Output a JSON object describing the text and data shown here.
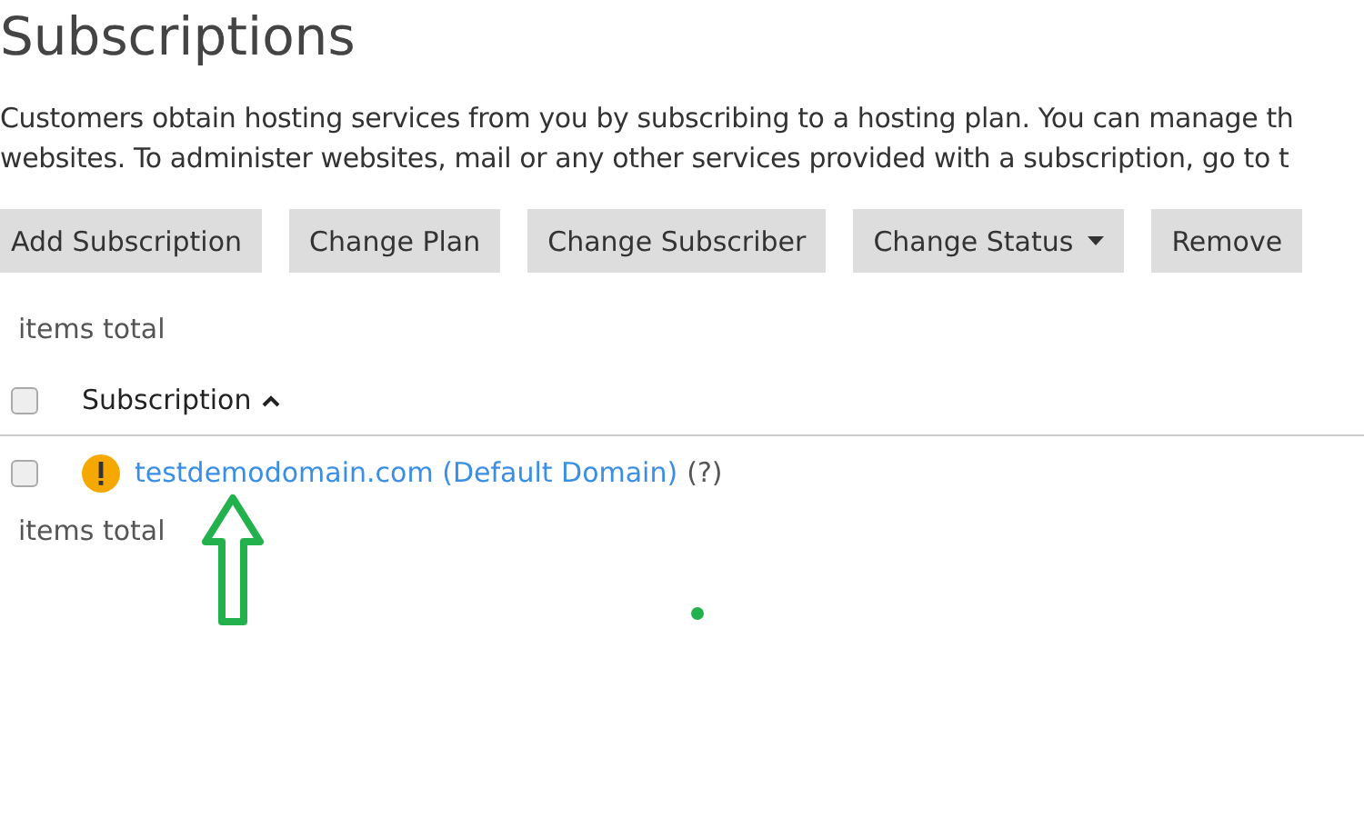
{
  "title": "Subscriptions",
  "description": [
    "Customers obtain hosting services from you by subscribing to a hosting plan. You can manage th",
    "websites. To administer websites, mail or any other services provided with a subscription, go to t"
  ],
  "toolbar": [
    {
      "label": "Add Subscription",
      "kind": "button"
    },
    {
      "label": "Change Plan",
      "kind": "button"
    },
    {
      "label": "Change Subscriber",
      "kind": "button"
    },
    {
      "label": "Change Status",
      "kind": "dropdown"
    },
    {
      "label": "Remove",
      "kind": "button"
    }
  ],
  "items_total_top": "items total",
  "table": {
    "select_all": {
      "checked": false
    },
    "columns": [
      {
        "label": "Subscription",
        "sorted_ascending": true
      }
    ],
    "rows": [
      {
        "checked": false,
        "warning": true,
        "domain": "testdemodomain.com (Default Domain)",
        "help": "(?)"
      }
    ]
  },
  "items_total_bottom": "items total"
}
